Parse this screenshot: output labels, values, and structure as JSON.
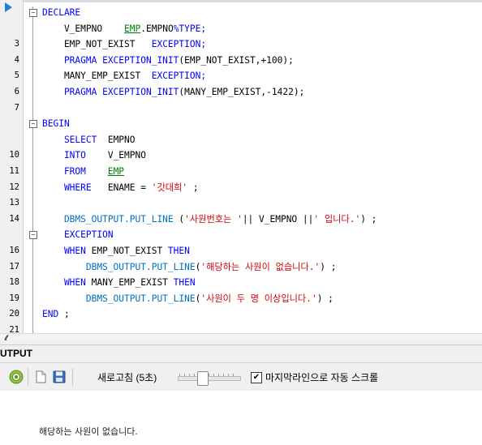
{
  "colors": {
    "keyword": "#0000ff",
    "plain": "#000000",
    "string": "#d3000b",
    "builtin": "#0070c0",
    "underline_link": "#008000",
    "comment": "#ff0000"
  },
  "editor": {
    "lines": [
      {
        "num": "",
        "fold": "minus",
        "tokens": [
          {
            "t": "DECLARE",
            "c": "keyword"
          }
        ]
      },
      {
        "num": "",
        "fold": "",
        "tokens": [
          {
            "t": "    V_EMPNO    ",
            "c": "plain"
          },
          {
            "t": "EMP",
            "c": "link"
          },
          {
            "t": ".EMPNO",
            "c": "plain"
          },
          {
            "t": "%TYPE;",
            "c": "keyword"
          }
        ]
      },
      {
        "num": "3",
        "fold": "",
        "tokens": [
          {
            "t": "    EMP_NOT_EXIST   ",
            "c": "plain"
          },
          {
            "t": "EXCEPTION;",
            "c": "keyword"
          }
        ]
      },
      {
        "num": "4",
        "fold": "",
        "tokens": [
          {
            "t": "    PRAGMA EXCEPTION_INIT",
            "c": "keyword"
          },
          {
            "t": "(EMP_NOT_EXIST,+100);",
            "c": "plain"
          }
        ]
      },
      {
        "num": "5",
        "fold": "",
        "tokens": [
          {
            "t": "    MANY_EMP_EXIST  ",
            "c": "plain"
          },
          {
            "t": "EXCEPTION;",
            "c": "keyword"
          }
        ]
      },
      {
        "num": "6",
        "fold": "",
        "tokens": [
          {
            "t": "    PRAGMA EXCEPTION_INIT",
            "c": "keyword"
          },
          {
            "t": "(MANY_EMP_EXIST,-1422);",
            "c": "plain"
          }
        ]
      },
      {
        "num": "7",
        "fold": "",
        "tokens": [
          {
            "t": "",
            "c": "plain"
          }
        ]
      },
      {
        "num": "",
        "fold": "minus",
        "tokens": [
          {
            "t": "BEGIN",
            "c": "keyword"
          }
        ]
      },
      {
        "num": "",
        "fold": "",
        "tokens": [
          {
            "t": "    SELECT  ",
            "c": "keyword"
          },
          {
            "t": "EMPNO",
            "c": "plain"
          }
        ]
      },
      {
        "num": "10",
        "fold": "",
        "tokens": [
          {
            "t": "    INTO    ",
            "c": "keyword"
          },
          {
            "t": "V_EMPNO",
            "c": "plain"
          }
        ]
      },
      {
        "num": "11",
        "fold": "",
        "tokens": [
          {
            "t": "    FROM    ",
            "c": "keyword"
          },
          {
            "t": "EMP",
            "c": "link"
          }
        ]
      },
      {
        "num": "12",
        "fold": "",
        "tokens": [
          {
            "t": "    WHERE   ",
            "c": "keyword"
          },
          {
            "t": "ENAME = ",
            "c": "plain"
          },
          {
            "t": "'갓대희'",
            "c": "string"
          },
          {
            "t": " ;",
            "c": "plain"
          }
        ]
      },
      {
        "num": "13",
        "fold": "",
        "tokens": [
          {
            "t": "",
            "c": "plain"
          }
        ]
      },
      {
        "num": "14",
        "fold": "",
        "tokens": [
          {
            "t": "    DBMS_OUTPUT.PUT_LINE ",
            "c": "builtin"
          },
          {
            "t": "(",
            "c": "plain"
          },
          {
            "t": "'사원번호는 '",
            "c": "string"
          },
          {
            "t": "|| V_EMPNO ||",
            "c": "plain"
          },
          {
            "t": "' 입니다.'",
            "c": "string"
          },
          {
            "t": ") ;",
            "c": "plain"
          }
        ]
      },
      {
        "num": "",
        "fold": "minus",
        "tokens": [
          {
            "t": "    EXCEPTION",
            "c": "keyword"
          }
        ]
      },
      {
        "num": "16",
        "fold": "",
        "tokens": [
          {
            "t": "    WHEN ",
            "c": "keyword"
          },
          {
            "t": "EMP_NOT_EXIST ",
            "c": "plain"
          },
          {
            "t": "THEN",
            "c": "keyword"
          }
        ]
      },
      {
        "num": "17",
        "fold": "",
        "tokens": [
          {
            "t": "        DBMS_OUTPUT.PUT_LINE",
            "c": "builtin"
          },
          {
            "t": "(",
            "c": "plain"
          },
          {
            "t": "'해당하는 사원이 없습니다.'",
            "c": "string"
          },
          {
            "t": ") ;",
            "c": "plain"
          }
        ]
      },
      {
        "num": "18",
        "fold": "",
        "tokens": [
          {
            "t": "    WHEN ",
            "c": "keyword"
          },
          {
            "t": "MANY_EMP_EXIST ",
            "c": "plain"
          },
          {
            "t": "THEN",
            "c": "keyword"
          }
        ]
      },
      {
        "num": "19",
        "fold": "",
        "tokens": [
          {
            "t": "        DBMS_OUTPUT.PUT_LINE",
            "c": "builtin"
          },
          {
            "t": "(",
            "c": "plain"
          },
          {
            "t": "'사원이 두 명 이상입니다.'",
            "c": "string"
          },
          {
            "t": ") ;",
            "c": "plain"
          }
        ]
      },
      {
        "num": "20",
        "fold": "end",
        "tokens": [
          {
            "t": "END",
            "c": "keyword"
          },
          {
            "t": " ;",
            "c": "plain"
          }
        ]
      },
      {
        "num": "21",
        "fold": "",
        "tokens": [
          {
            "t": "",
            "c": "plain"
          }
        ]
      }
    ],
    "scroll_left_icon": "chevron-left-icon"
  },
  "output": {
    "title": "UTPUT",
    "refresh_label": "새로고침 (5초)",
    "autoscroll_checked": true,
    "autoscroll_label": "마지막라인으로 자동 스크롤",
    "message": "해당하는 사원이 없습니다.",
    "icons": [
      "settings-icon",
      "new-document-icon",
      "save-icon"
    ]
  }
}
